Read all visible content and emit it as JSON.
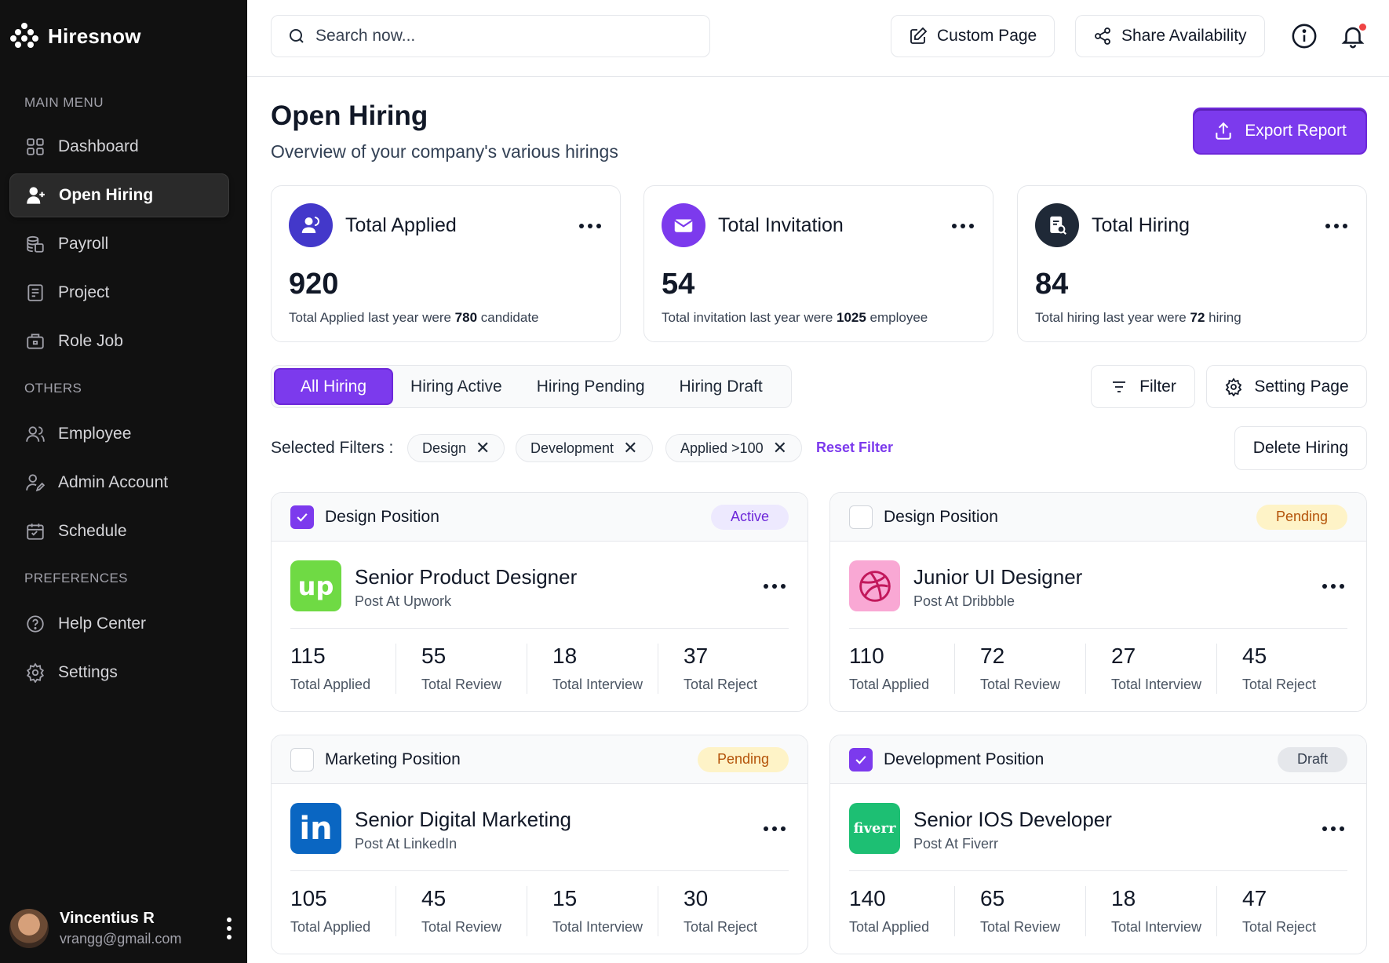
{
  "brand": {
    "name": "Hiresnow"
  },
  "sidebar": {
    "sections": [
      "MAIN MENU",
      "OTHERS",
      "PREFERENCES"
    ],
    "main": [
      {
        "label": "Dashboard",
        "icon": "grid-icon"
      },
      {
        "label": "Open Hiring",
        "icon": "user-plus-icon",
        "active": true
      },
      {
        "label": "Payroll",
        "icon": "coins-icon"
      },
      {
        "label": "Project",
        "icon": "clipboard-icon"
      },
      {
        "label": "Role Job",
        "icon": "briefcase-icon"
      }
    ],
    "others": [
      {
        "label": "Employee",
        "icon": "users-icon"
      },
      {
        "label": "Admin Account",
        "icon": "user-edit-icon"
      },
      {
        "label": "Schedule",
        "icon": "calendar-icon"
      }
    ],
    "preferences": [
      {
        "label": "Help Center",
        "icon": "help-icon"
      },
      {
        "label": "Settings",
        "icon": "gear-icon"
      }
    ],
    "user": {
      "name": "Vincentius R",
      "email": "vrangg@gmail.com"
    }
  },
  "topbar": {
    "search_placeholder": "Search now...",
    "custom_page": "Custom Page",
    "share": "Share Availability"
  },
  "header": {
    "title": "Open Hiring",
    "subtitle": "Overview of your company's various hirings",
    "export": "Export Report"
  },
  "stats": [
    {
      "title": "Total Applied",
      "value": "920",
      "note_pre": "Total Applied last year were ",
      "note_num": "780",
      "note_post": " candidate",
      "color": "#4338ca"
    },
    {
      "title": "Total Invitation",
      "value": "54",
      "note_pre": "Total invitation last year were ",
      "note_num": "1025",
      "note_post": " employee",
      "color": "#7c3aed"
    },
    {
      "title": "Total Hiring",
      "value": "84",
      "note_pre": "Total hiring last year were ",
      "note_num": "72",
      "note_post": " hiring",
      "color": "#1f2937"
    }
  ],
  "tabs": [
    "All Hiring",
    "Hiring Active",
    "Hiring Pending",
    "Hiring Draft"
  ],
  "actions": {
    "filter": "Filter",
    "setting": "Setting Page",
    "delete": "Delete Hiring"
  },
  "filters": {
    "label": "Selected Filters :",
    "chips": [
      "Design",
      "Development",
      "Applied >100"
    ],
    "reset": "Reset Filter"
  },
  "cards": [
    {
      "category": "Design Position",
      "status": "Active",
      "checked": true,
      "title": "Senior Product Designer",
      "source": "Post At Upwork",
      "logo_text": "up",
      "logo_color": "#6fda44",
      "metrics": [
        {
          "v": "115",
          "l": "Total Applied"
        },
        {
          "v": "55",
          "l": "Total Review"
        },
        {
          "v": "18",
          "l": "Total Interview"
        },
        {
          "v": "37",
          "l": "Total Reject"
        }
      ]
    },
    {
      "category": "Design Position",
      "status": "Pending",
      "checked": false,
      "title": "Junior UI Designer",
      "source": "Post At Dribbble",
      "logo_text": "",
      "logo_color": "#f9a8d4",
      "metrics": [
        {
          "v": "110",
          "l": "Total Applied"
        },
        {
          "v": "72",
          "l": "Total Review"
        },
        {
          "v": "27",
          "l": "Total Interview"
        },
        {
          "v": "45",
          "l": "Total Reject"
        }
      ]
    },
    {
      "category": "Marketing Position",
      "status": "Pending",
      "checked": false,
      "title": "Senior Digital Marketing",
      "source": "Post At LinkedIn",
      "logo_text": "in",
      "logo_color": "#0a66c2",
      "metrics": [
        {
          "v": "105",
          "l": "Total Applied"
        },
        {
          "v": "45",
          "l": "Total Review"
        },
        {
          "v": "15",
          "l": "Total Interview"
        },
        {
          "v": "30",
          "l": "Total Reject"
        }
      ]
    },
    {
      "category": "Development Position",
      "status": "Draft",
      "checked": true,
      "title": "Senior IOS Developer",
      "source": "Post At Fiverr",
      "logo_text": "fiverr",
      "logo_color": "#1dbf73",
      "metrics": [
        {
          "v": "140",
          "l": "Total Applied"
        },
        {
          "v": "65",
          "l": "Total Review"
        },
        {
          "v": "18",
          "l": "Total Interview"
        },
        {
          "v": "47",
          "l": "Total Reject"
        }
      ]
    }
  ]
}
